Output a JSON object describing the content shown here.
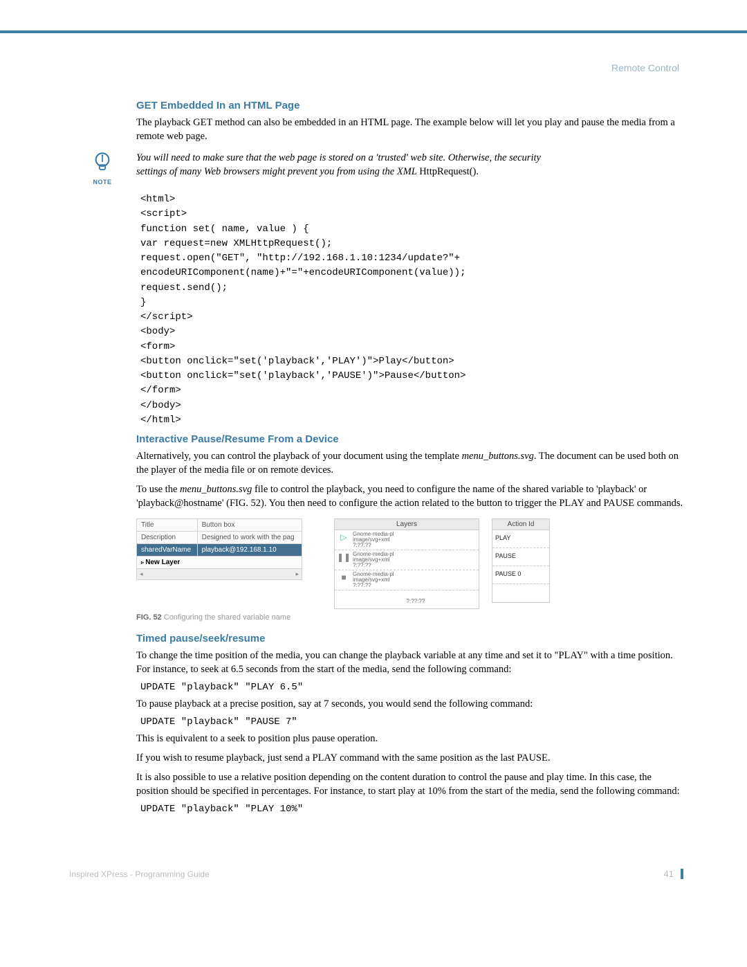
{
  "header": {
    "section": "Remote Control"
  },
  "sections": {
    "h1": "GET Embedded In an HTML Page",
    "p1": "The playback GET method can also be embedded in an HTML page. The example below will let you play and pause the media from a remote web page.",
    "note_icon_label": "NOTE",
    "note_italic": "You will need to make sure that the web page is stored on a 'trusted' web site. Otherwise, the security settings of many Web browsers might prevent you from using the XML ",
    "note_tail": "HttpRequest().",
    "code1": "<html>\n<script>\nfunction set( name, value ) {\nvar request=new XMLHttpRequest();\nrequest.open(\"GET\", \"http://192.168.1.10:1234/update?\"+\nencodeURIComponent(name)+\"=\"+encodeURIComponent(value));\nrequest.send();\n}\n</script>\n<body>\n<form>\n<button onclick=\"set('playback','PLAY')\">Play</button>\n<button onclick=\"set('playback','PAUSE')\">Pause</button>\n</form>\n</body>\n</html>",
    "h2": "Interactive Pause/Resume From a Device",
    "p2a_a": "Alternatively, you can control the playback of your document using the template ",
    "p2a_i": "menu_buttons.svg",
    "p2a_b": ". The document can be used both on the player of the media file or on remote devices.",
    "p2b_a": "To use the ",
    "p2b_i": "menu_buttons.svg",
    "p2b_b": " file to control the playback, you need to configure the name of the shared variable to 'playback' or 'playback@hostname' (FIG. 52). You then need to configure the action related to the button to trigger the PLAY and PAUSE commands.",
    "h3": "Timed pause/seek/resume",
    "p3": "To change the time position of the media, you can change the playback variable at any time and set it to \"PLAY\" with a time position. For instance, to seek at 6.5 seconds from the start of the media, send the following command:",
    "code2": "UPDATE \"playback\" \"PLAY 6.5\"",
    "p4": "To pause playback at a precise position, say at 7 seconds, you would send the following command:",
    "code3": "UPDATE \"playback\" \"PAUSE 7\"",
    "p5": "This is equivalent to a seek to position plus pause operation.",
    "p6": "If you wish to resume playback, just send a PLAY command with the same position as the last PAUSE.",
    "p7": "It is also possible to use a relative position depending on the content duration to control the pause and play time. In this case, the position should be specified in percentages. For instance, to start play at 10% from the start of the media, send the following command:",
    "code4": "UPDATE \"playback\" \"PLAY 10%\""
  },
  "figure": {
    "prop_title_label": "Title",
    "prop_title_val": "Button box",
    "prop_desc_label": "Description",
    "prop_desc_val": "Designed to work with the pag",
    "prop_sv_label": "sharedVarName",
    "prop_sv_val": "playback@192.168.1.10",
    "new_layer": "New Layer",
    "layers_head": "Layers",
    "layer_txt_a": "Gnome-media-pl",
    "layer_txt_b": "image/svg+xml",
    "layer_txt_c": "?:??:??",
    "action_head": "Action Id",
    "action_play": "PLAY",
    "action_pause": "PAUSE",
    "action_pause0": "PAUSE 0",
    "caption_b": "FIG. 52",
    "caption_t": "  Configuring the shared variable name"
  },
  "footer": {
    "left": "Inspired XPress - Programming Guide",
    "page": "41"
  }
}
